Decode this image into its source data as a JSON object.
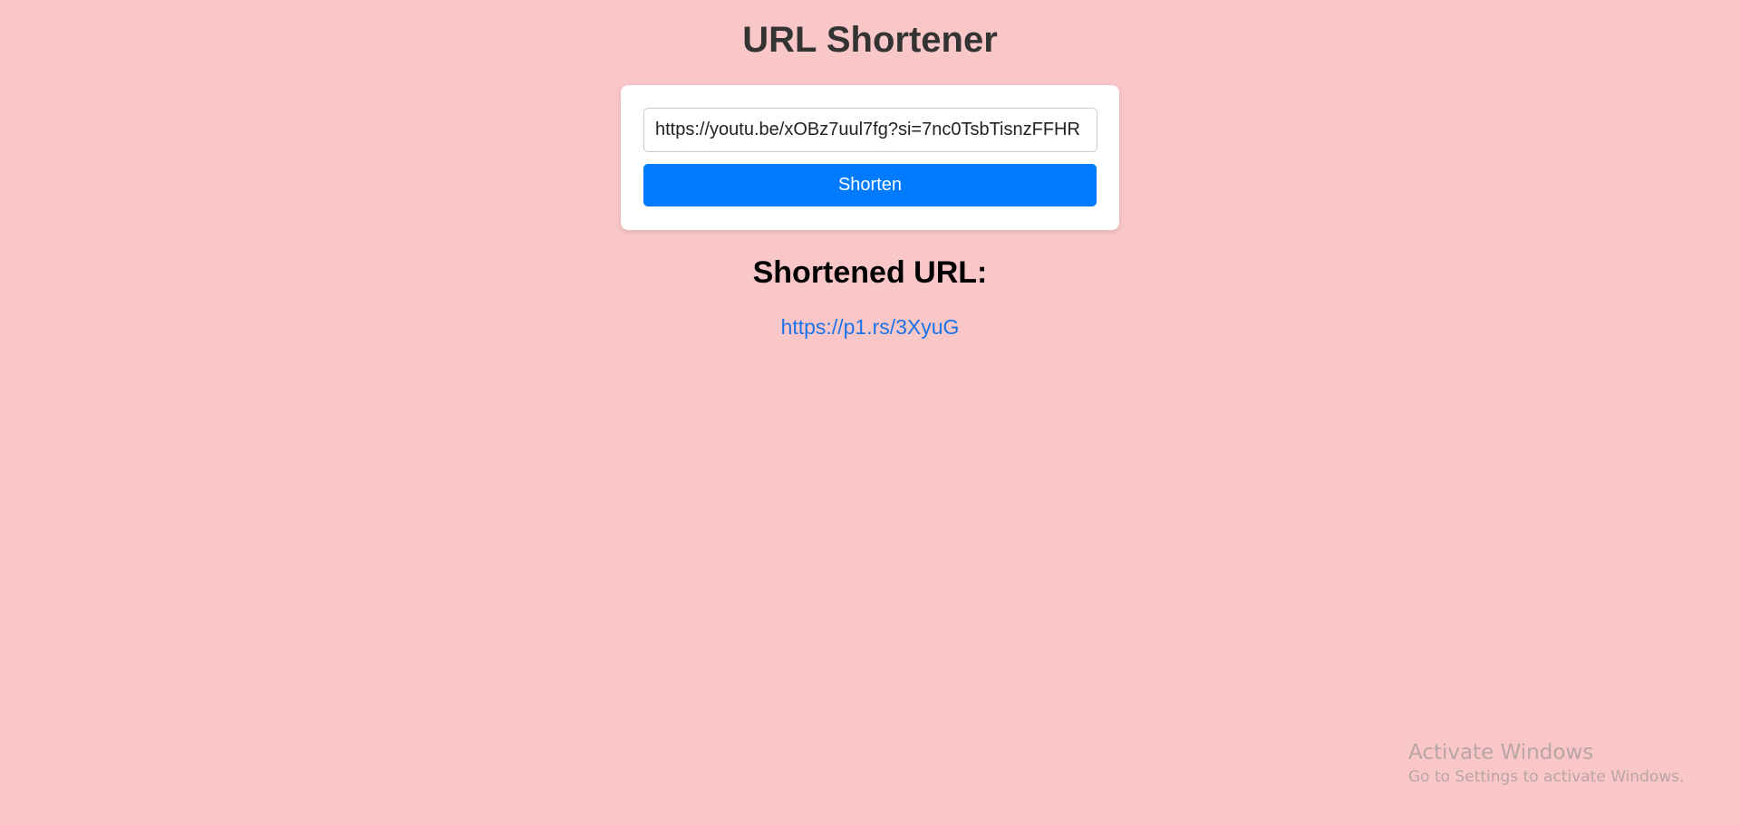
{
  "page": {
    "title": "URL Shortener",
    "background_color": "#fac7c8"
  },
  "form": {
    "url_value": "https://youtu.be/xOBz7uul7fg?si=7nc0TsbTisnzFFHR",
    "shorten_label": "Shorten",
    "button_color": "#007bff"
  },
  "result": {
    "heading": "Shortened URL:",
    "short_url": "https://p1.rs/3XyuG"
  },
  "watermark": {
    "title": "Activate Windows",
    "subtitle": "Go to Settings to activate Windows."
  }
}
